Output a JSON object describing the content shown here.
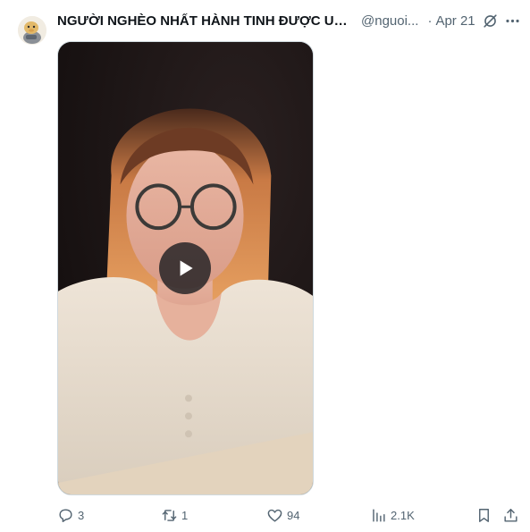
{
  "post": {
    "display_name": "NGƯỜI NGHÈO NHẤT HÀNH TINH ĐƯỢC UN...",
    "handle": "@nguoi...",
    "separator": "·",
    "time": "Apr 21"
  },
  "media": {
    "type": "video",
    "play_icon": "play-icon"
  },
  "actions": {
    "replies": "3",
    "reposts": "1",
    "likes": "94",
    "views": "2.1K"
  },
  "icons": {
    "reply": "reply-icon",
    "repost": "repost-icon",
    "like": "heart-icon",
    "views": "analytics-icon",
    "bookmark": "bookmark-icon",
    "share": "share-icon",
    "grok": "grok-icon",
    "more": "more-icon"
  },
  "colors": {
    "text": "#0f1419",
    "muted": "#536471",
    "border": "#cfd9de"
  }
}
